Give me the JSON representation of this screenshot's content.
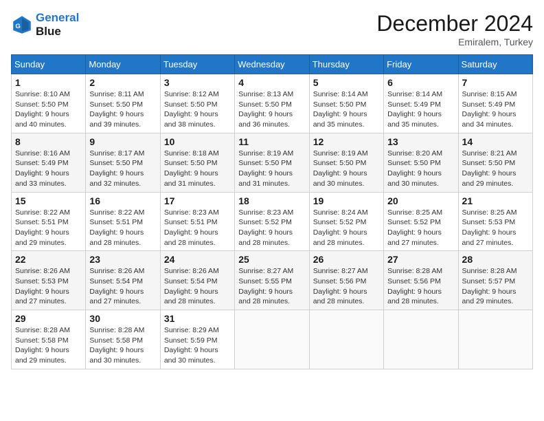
{
  "header": {
    "logo_line1": "General",
    "logo_line2": "Blue",
    "month": "December 2024",
    "location": "Emiralem, Turkey"
  },
  "days_of_week": [
    "Sunday",
    "Monday",
    "Tuesday",
    "Wednesday",
    "Thursday",
    "Friday",
    "Saturday"
  ],
  "weeks": [
    [
      {
        "day": 1,
        "sunrise": "8:10 AM",
        "sunset": "5:50 PM",
        "daylight": "9 hours and 40 minutes."
      },
      {
        "day": 2,
        "sunrise": "8:11 AM",
        "sunset": "5:50 PM",
        "daylight": "9 hours and 39 minutes."
      },
      {
        "day": 3,
        "sunrise": "8:12 AM",
        "sunset": "5:50 PM",
        "daylight": "9 hours and 38 minutes."
      },
      {
        "day": 4,
        "sunrise": "8:13 AM",
        "sunset": "5:50 PM",
        "daylight": "9 hours and 36 minutes."
      },
      {
        "day": 5,
        "sunrise": "8:14 AM",
        "sunset": "5:50 PM",
        "daylight": "9 hours and 35 minutes."
      },
      {
        "day": 6,
        "sunrise": "8:14 AM",
        "sunset": "5:49 PM",
        "daylight": "9 hours and 35 minutes."
      },
      {
        "day": 7,
        "sunrise": "8:15 AM",
        "sunset": "5:49 PM",
        "daylight": "9 hours and 34 minutes."
      }
    ],
    [
      {
        "day": 8,
        "sunrise": "8:16 AM",
        "sunset": "5:49 PM",
        "daylight": "9 hours and 33 minutes."
      },
      {
        "day": 9,
        "sunrise": "8:17 AM",
        "sunset": "5:50 PM",
        "daylight": "9 hours and 32 minutes."
      },
      {
        "day": 10,
        "sunrise": "8:18 AM",
        "sunset": "5:50 PM",
        "daylight": "9 hours and 31 minutes."
      },
      {
        "day": 11,
        "sunrise": "8:19 AM",
        "sunset": "5:50 PM",
        "daylight": "9 hours and 31 minutes."
      },
      {
        "day": 12,
        "sunrise": "8:19 AM",
        "sunset": "5:50 PM",
        "daylight": "9 hours and 30 minutes."
      },
      {
        "day": 13,
        "sunrise": "8:20 AM",
        "sunset": "5:50 PM",
        "daylight": "9 hours and 30 minutes."
      },
      {
        "day": 14,
        "sunrise": "8:21 AM",
        "sunset": "5:50 PM",
        "daylight": "9 hours and 29 minutes."
      }
    ],
    [
      {
        "day": 15,
        "sunrise": "8:22 AM",
        "sunset": "5:51 PM",
        "daylight": "9 hours and 29 minutes."
      },
      {
        "day": 16,
        "sunrise": "8:22 AM",
        "sunset": "5:51 PM",
        "daylight": "9 hours and 28 minutes."
      },
      {
        "day": 17,
        "sunrise": "8:23 AM",
        "sunset": "5:51 PM",
        "daylight": "9 hours and 28 minutes."
      },
      {
        "day": 18,
        "sunrise": "8:23 AM",
        "sunset": "5:52 PM",
        "daylight": "9 hours and 28 minutes."
      },
      {
        "day": 19,
        "sunrise": "8:24 AM",
        "sunset": "5:52 PM",
        "daylight": "9 hours and 28 minutes."
      },
      {
        "day": 20,
        "sunrise": "8:25 AM",
        "sunset": "5:52 PM",
        "daylight": "9 hours and 27 minutes."
      },
      {
        "day": 21,
        "sunrise": "8:25 AM",
        "sunset": "5:53 PM",
        "daylight": "9 hours and 27 minutes."
      }
    ],
    [
      {
        "day": 22,
        "sunrise": "8:26 AM",
        "sunset": "5:53 PM",
        "daylight": "9 hours and 27 minutes."
      },
      {
        "day": 23,
        "sunrise": "8:26 AM",
        "sunset": "5:54 PM",
        "daylight": "9 hours and 27 minutes."
      },
      {
        "day": 24,
        "sunrise": "8:26 AM",
        "sunset": "5:54 PM",
        "daylight": "9 hours and 28 minutes."
      },
      {
        "day": 25,
        "sunrise": "8:27 AM",
        "sunset": "5:55 PM",
        "daylight": "9 hours and 28 minutes."
      },
      {
        "day": 26,
        "sunrise": "8:27 AM",
        "sunset": "5:56 PM",
        "daylight": "9 hours and 28 minutes."
      },
      {
        "day": 27,
        "sunrise": "8:28 AM",
        "sunset": "5:56 PM",
        "daylight": "9 hours and 28 minutes."
      },
      {
        "day": 28,
        "sunrise": "8:28 AM",
        "sunset": "5:57 PM",
        "daylight": "9 hours and 29 minutes."
      }
    ],
    [
      {
        "day": 29,
        "sunrise": "8:28 AM",
        "sunset": "5:58 PM",
        "daylight": "9 hours and 29 minutes."
      },
      {
        "day": 30,
        "sunrise": "8:28 AM",
        "sunset": "5:58 PM",
        "daylight": "9 hours and 30 minutes."
      },
      {
        "day": 31,
        "sunrise": "8:29 AM",
        "sunset": "5:59 PM",
        "daylight": "9 hours and 30 minutes."
      },
      null,
      null,
      null,
      null
    ]
  ]
}
